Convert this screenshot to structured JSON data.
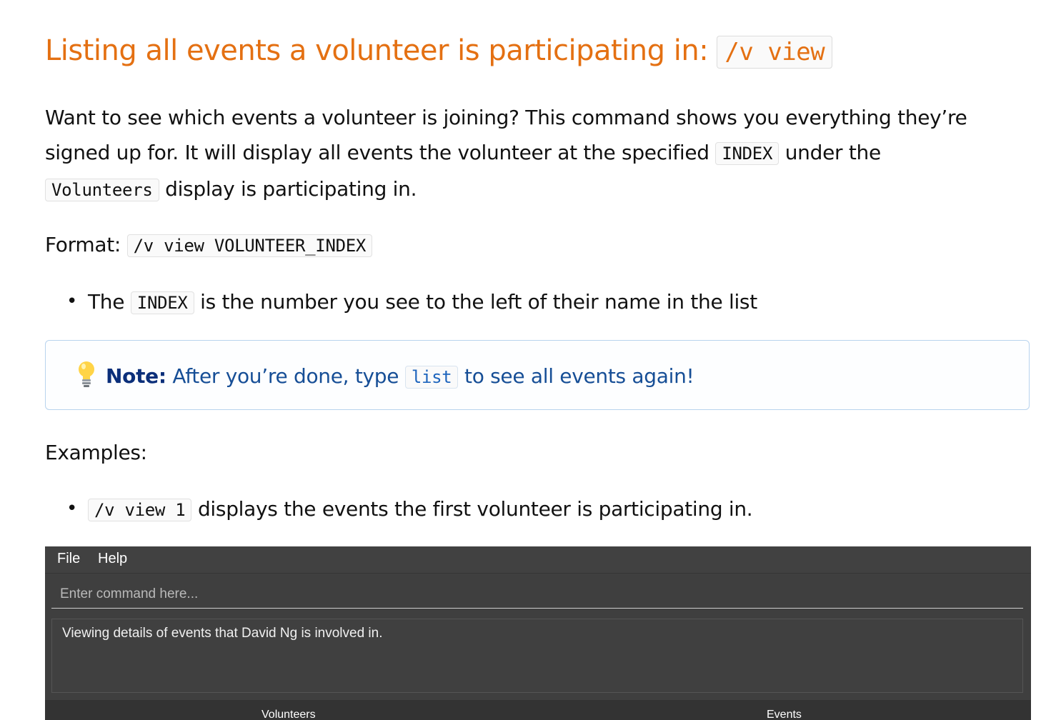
{
  "title": {
    "text": "Listing all events a volunteer is participating in:",
    "code": "/v view"
  },
  "intro": {
    "part1": "Want to see which events a volunteer is joining? This command shows you everything they’re signed up for. It will display all events the volunteer at the specified",
    "code1": "INDEX",
    "part2": "under the",
    "code2": "Volunteers",
    "part3": "display is participating in."
  },
  "format": {
    "label": "Format:",
    "code": "/v view VOLUNTEER_INDEX"
  },
  "bullet_index": {
    "pre": "The",
    "code": "INDEX",
    "post": "is the number you see to the left of their name in the list"
  },
  "note": {
    "icon": "lightbulb-icon",
    "label": "Note:",
    "pre": "After you’re done, type",
    "code": "list",
    "post": "to see all events again!"
  },
  "examples": {
    "label": "Examples:",
    "items": [
      {
        "code": "/v view 1",
        "text": "displays the events the first volunteer is participating in."
      }
    ]
  },
  "app": {
    "menu": [
      "File",
      "Help"
    ],
    "command_placeholder": "Enter command here...",
    "result_text": "Viewing details of events that David Ng is involved in.",
    "tabs": [
      "Volunteers",
      "Events"
    ]
  },
  "colors": {
    "heading": "#e47012",
    "note_text": "#164e96",
    "note_border": "#b8d3ee",
    "app_bg": "#3f3f3f"
  }
}
